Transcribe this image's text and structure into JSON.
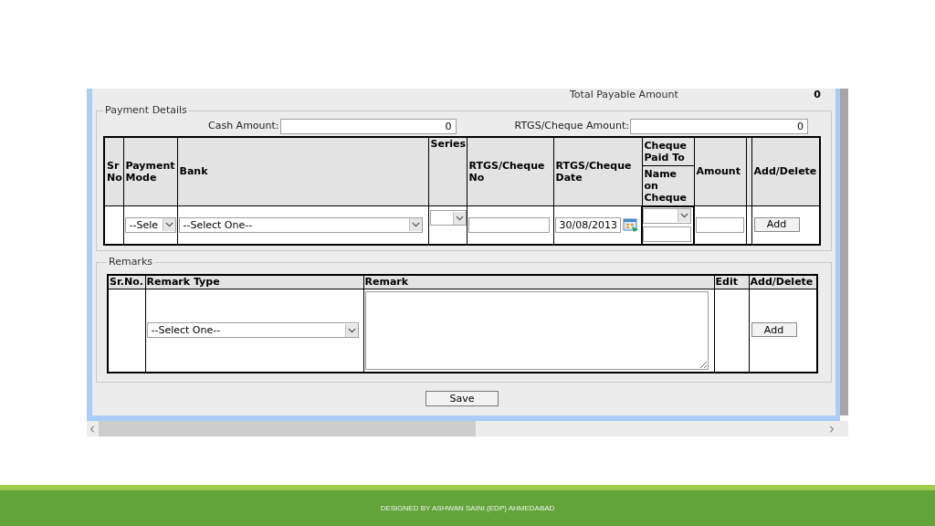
{
  "total_payable": {
    "label": "Total Payable Amount",
    "value": "0"
  },
  "payment_details": {
    "legend": "Payment Details",
    "cash_amount": {
      "label": "Cash Amount:",
      "value": "0"
    },
    "rtgs_cheque_amount": {
      "label": "RTGS/Cheque Amount:",
      "value": "0"
    },
    "columns": [
      "Sr No",
      "Payment Mode",
      "Bank",
      "Series",
      "RTGS/Cheque No",
      "RTGS/Cheque Date",
      "Cheque Paid To",
      "Name on Cheque",
      "Amount",
      "Add/Delete"
    ],
    "row": {
      "payment_mode": "--Sele",
      "bank": "--Select One--",
      "date": "30/08/2013",
      "button": "Add"
    }
  },
  "remarks": {
    "legend": "Remarks",
    "columns": [
      "Sr.No.",
      "Remark Type",
      "Remark",
      "Edit",
      "Add/Delete"
    ],
    "row": {
      "remark_type": "--Select One--",
      "button": "Add"
    }
  },
  "save_button": "Save",
  "footer": "DESIGNED BY ASHWAN SAINI (EDP) AHMEDABAD"
}
